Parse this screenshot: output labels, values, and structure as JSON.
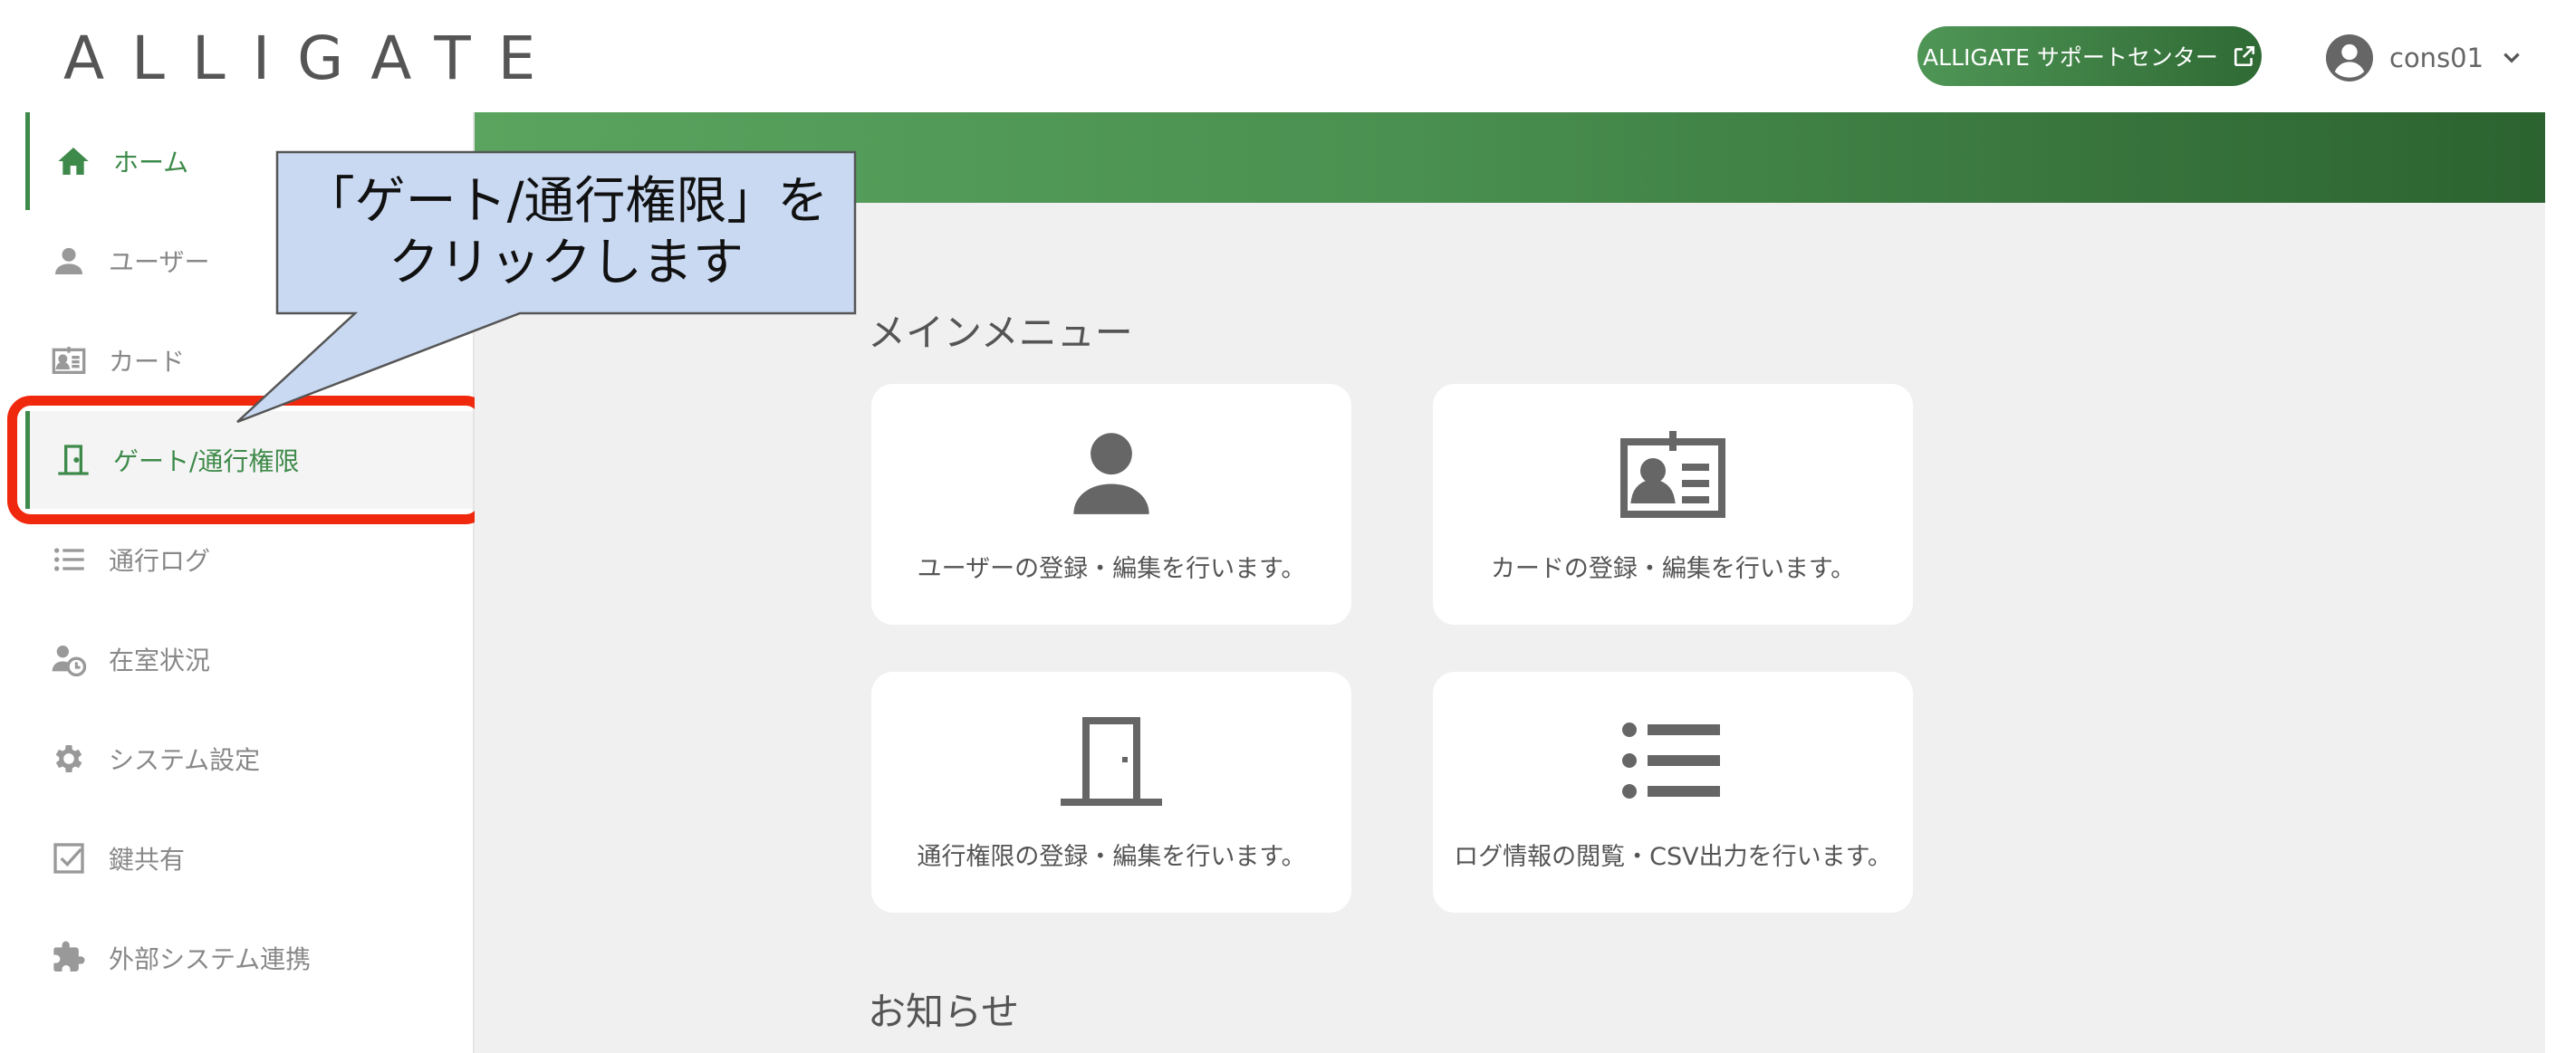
{
  "header": {
    "logo_text": "ALLIGATE",
    "support_button_label": "ALLIGATE サポートセンター",
    "username": "cons01"
  },
  "sidebar": {
    "items": [
      {
        "label": "ホーム",
        "icon": "home-icon"
      },
      {
        "label": "ユーザー",
        "icon": "user-icon"
      },
      {
        "label": "カード",
        "icon": "id-card-icon"
      },
      {
        "label": "ゲート/通行権限",
        "icon": "door-icon"
      },
      {
        "label": "通行ログ",
        "icon": "list-icon"
      },
      {
        "label": "在室状況",
        "icon": "user-clock-icon"
      },
      {
        "label": "システム設定",
        "icon": "gear-icon"
      },
      {
        "label": "鍵共有",
        "icon": "checkbox-icon"
      },
      {
        "label": "外部システム連携",
        "icon": "puzzle-icon"
      }
    ]
  },
  "main": {
    "main_menu_title": "メインメニュー",
    "cards": [
      {
        "text": "ユーザーの登録・編集を行います。",
        "icon": "user-icon"
      },
      {
        "text": "カードの登録・編集を行います。",
        "icon": "id-card-icon"
      },
      {
        "text": "通行権限の登録・編集を行います。",
        "icon": "door-icon"
      },
      {
        "text": "ログ情報の閲覧・CSV出力を行います。",
        "icon": "list-icon"
      }
    ],
    "news_title": "お知らせ"
  },
  "callout": {
    "line1": "「ゲート/通行権限」を",
    "line2": "クリックします"
  },
  "colors": {
    "accent_green": "#3e8a4a",
    "highlight_red": "#f0290e",
    "callout_fill": "#c9d9f2"
  }
}
